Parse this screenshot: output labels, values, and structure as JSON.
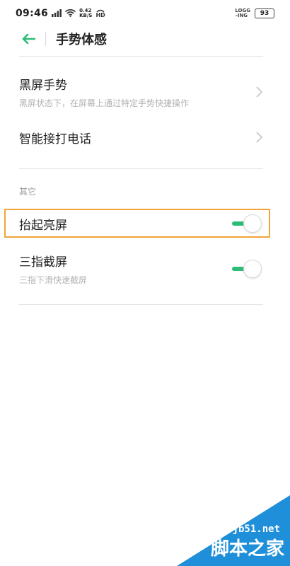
{
  "status_bar": {
    "time": "09:46",
    "signal_icon": "signal-icon",
    "wifi_icon": "wifi-icon",
    "net_speed_value": "0.42",
    "net_speed_unit": "KB/S",
    "hd_label": "HD",
    "logging_top": "LOGG",
    "logging_bottom": "–ING",
    "battery": "93"
  },
  "header": {
    "back_icon": "back-arrow-icon",
    "title": "手势体感"
  },
  "gestures": [
    {
      "title": "黑屏手势",
      "subtitle": "黑屏状态下，在屏幕上通过特定手势快捷操作"
    },
    {
      "title": "智能接打电话",
      "subtitle": ""
    }
  ],
  "other_section": {
    "label": "其它",
    "items": [
      {
        "title": "抬起亮屏",
        "subtitle": "",
        "enabled": true
      },
      {
        "title": "三指截屏",
        "subtitle": "三指下滑快速截屏",
        "enabled": true
      }
    ]
  },
  "colors": {
    "accent": "#2bbd76",
    "highlight_border": "#f0a43a",
    "watermark_bg": "#1e8fd8"
  },
  "watermark": {
    "url": "jb51.net",
    "text": "脚本之家"
  }
}
